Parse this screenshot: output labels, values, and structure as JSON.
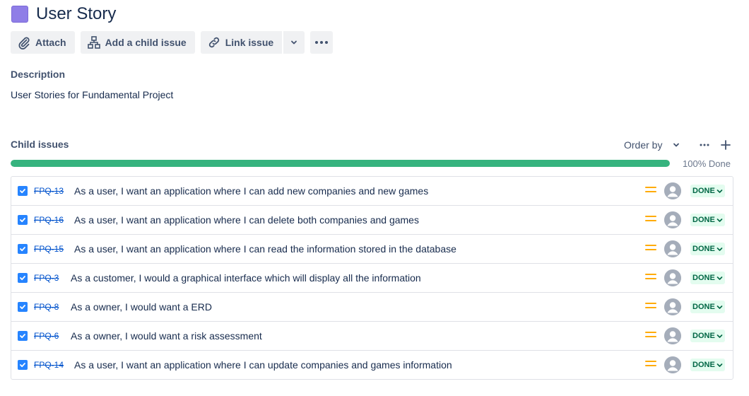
{
  "issue": {
    "type_icon": "user-story-icon",
    "type_color": "#8f7ee7",
    "title": "User Story"
  },
  "toolbar": {
    "attach_label": "Attach",
    "add_child_label": "Add a child issue",
    "link_issue_label": "Link issue"
  },
  "description": {
    "label": "Description",
    "text": "User Stories for Fundamental Project"
  },
  "child_issues": {
    "label": "Child issues",
    "order_by_label": "Order by",
    "progress_percent": 100,
    "progress_text": "100% Done",
    "items": [
      {
        "key": "FPQ-13",
        "summary": "As a user, I want an application where I can add new companies and new games",
        "status": "DONE",
        "priority": "medium"
      },
      {
        "key": "FPQ-16",
        "summary": "As a user, I want an application where I can delete both companies and games",
        "status": "DONE",
        "priority": "medium"
      },
      {
        "key": "FPQ-15",
        "summary": "As a user, I want an application where I can read the information stored in the database",
        "status": "DONE",
        "priority": "medium"
      },
      {
        "key": "FPQ-3",
        "summary": "As a customer, I would a graphical interface which will display all the information",
        "status": "DONE",
        "priority": "medium"
      },
      {
        "key": "FPQ-8",
        "summary": "As a owner, I would want a ERD",
        "status": "DONE",
        "priority": "medium"
      },
      {
        "key": "FPQ-6",
        "summary": "As a owner, I would want a risk assessment",
        "status": "DONE",
        "priority": "medium"
      },
      {
        "key": "FPQ-14",
        "summary": "As a user, I want an application where I can update companies and games information",
        "status": "DONE",
        "priority": "medium"
      }
    ]
  },
  "colors": {
    "progress": "#36b37e",
    "status_bg": "#e3fcef",
    "status_text": "#006644",
    "priority": "#ffab00",
    "link": "#0052cc"
  }
}
